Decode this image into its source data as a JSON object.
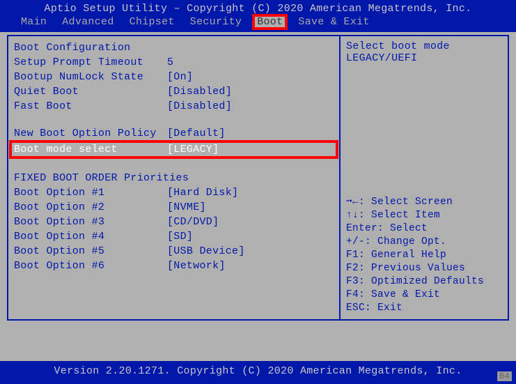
{
  "header": {
    "title": "Aptio Setup Utility – Copyright (C) 2020 American Megatrends, Inc.",
    "tabs": [
      "Main",
      "Advanced",
      "Chipset",
      "Security",
      "Boot",
      "Save & Exit"
    ],
    "active_tab_index": 4
  },
  "left": {
    "section1_title": "Boot Configuration",
    "items1": [
      {
        "label": "Setup Prompt Timeout",
        "value": "5"
      },
      {
        "label": "Bootup NumLock State",
        "value": "[On]"
      },
      {
        "label": "Quiet Boot",
        "value": "[Disabled]"
      },
      {
        "label": "Fast Boot",
        "value": "[Disabled]"
      }
    ],
    "items2": [
      {
        "label": "New Boot Option Policy",
        "value": "[Default]"
      },
      {
        "label": "Boot mode select",
        "value": "[LEGACY]"
      }
    ],
    "selected_index2": 1,
    "section2_title": "FIXED BOOT ORDER Priorities",
    "boot_order": [
      {
        "label": "Boot Option #1",
        "value": "[Hard Disk]"
      },
      {
        "label": "Boot Option #2",
        "value": "[NVME]"
      },
      {
        "label": "Boot Option #3",
        "value": "[CD/DVD]"
      },
      {
        "label": "Boot Option #4",
        "value": "[SD]"
      },
      {
        "label": "Boot Option #5",
        "value": "[USB Device]"
      },
      {
        "label": "Boot Option #6",
        "value": "[Network]"
      }
    ]
  },
  "right": {
    "help_top": "Select boot mode\nLEGACY/UEFI",
    "keys": [
      "➞←: Select Screen",
      "↑↓: Select Item",
      "Enter: Select",
      "+/-: Change Opt.",
      "F1: General Help",
      "F2: Previous Values",
      "F3: Optimized Defaults",
      "F4: Save & Exit",
      "ESC: Exit"
    ]
  },
  "footer": {
    "version": "Version 2.20.1271. Copyright (C) 2020 American Megatrends, Inc."
  },
  "corner": "B4"
}
